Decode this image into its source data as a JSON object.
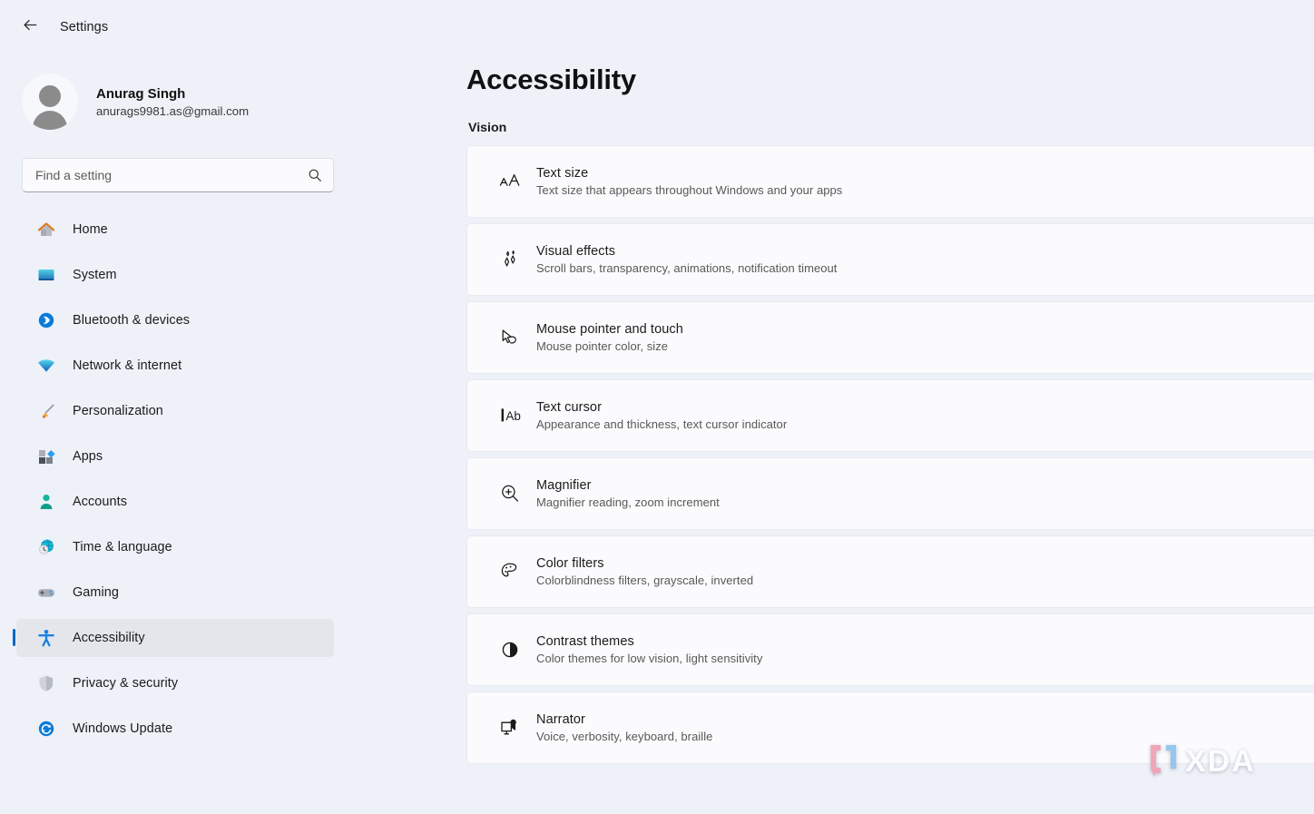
{
  "titlebar": {
    "back_icon": "back-arrow-icon",
    "title": "Settings"
  },
  "account": {
    "name": "Anurag Singh",
    "email": "anurags9981.as@gmail.com",
    "avatar_icon": "person-avatar-icon"
  },
  "search": {
    "placeholder": "Find a setting",
    "value": "",
    "icon": "search-icon"
  },
  "sidebar": {
    "items": [
      {
        "label": "Home",
        "icon": "home-icon",
        "selected": false
      },
      {
        "label": "System",
        "icon": "monitor-icon",
        "selected": false
      },
      {
        "label": "Bluetooth & devices",
        "icon": "bluetooth-icon",
        "selected": false
      },
      {
        "label": "Network & internet",
        "icon": "wifi-icon",
        "selected": false
      },
      {
        "label": "Personalization",
        "icon": "paintbrush-icon",
        "selected": false
      },
      {
        "label": "Apps",
        "icon": "apps-icon",
        "selected": false
      },
      {
        "label": "Accounts",
        "icon": "account-icon",
        "selected": false
      },
      {
        "label": "Time & language",
        "icon": "globe-clock-icon",
        "selected": false
      },
      {
        "label": "Gaming",
        "icon": "gamepad-icon",
        "selected": false
      },
      {
        "label": "Accessibility",
        "icon": "accessibility-icon",
        "selected": true
      },
      {
        "label": "Privacy & security",
        "icon": "shield-icon",
        "selected": false
      },
      {
        "label": "Windows Update",
        "icon": "update-icon",
        "selected": false
      }
    ]
  },
  "main": {
    "page_title": "Accessibility",
    "section_label": "Vision",
    "cards": [
      {
        "title": "Text size",
        "subtitle": "Text size that appears throughout Windows and your apps",
        "icon": "text-size-icon"
      },
      {
        "title": "Visual effects",
        "subtitle": "Scroll bars, transparency, animations, notification timeout",
        "icon": "sparkle-icon"
      },
      {
        "title": "Mouse pointer and touch",
        "subtitle": "Mouse pointer color, size",
        "icon": "mouse-pointer-icon"
      },
      {
        "title": "Text cursor",
        "subtitle": "Appearance and thickness, text cursor indicator",
        "icon": "text-cursor-icon"
      },
      {
        "title": "Magnifier",
        "subtitle": "Magnifier reading, zoom increment",
        "icon": "magnifier-icon"
      },
      {
        "title": "Color filters",
        "subtitle": "Colorblindness filters, grayscale, inverted",
        "icon": "color-palette-icon"
      },
      {
        "title": "Contrast themes",
        "subtitle": "Color themes for low vision, light sensitivity",
        "icon": "contrast-icon"
      },
      {
        "title": "Narrator",
        "subtitle": "Voice, verbosity, keyboard, braille",
        "icon": "narrator-icon"
      }
    ]
  },
  "watermark": {
    "text": "XDA"
  },
  "colors": {
    "background": "#eef1f8",
    "card": "#fbfbfd",
    "selection_accent": "#0067c0",
    "selection_fill": "#e4e6ec",
    "text_primary": "#1b1b1b",
    "text_secondary": "#585858"
  }
}
